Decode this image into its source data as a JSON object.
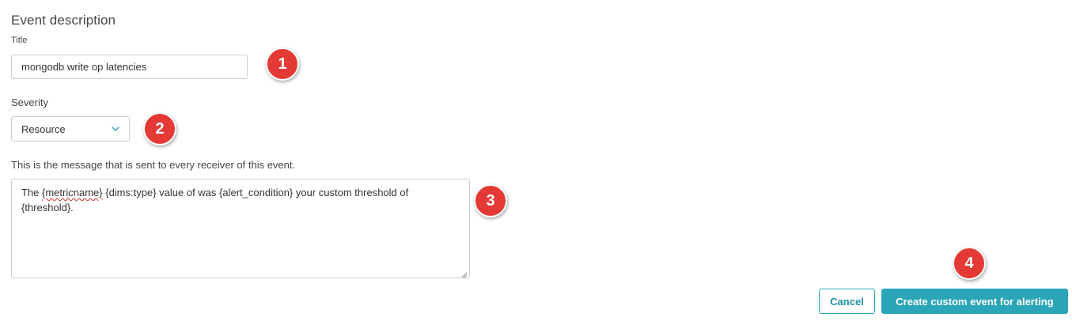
{
  "section": {
    "title": "Event description"
  },
  "title_field": {
    "label": "Title",
    "value": "mongodb write op latencies"
  },
  "severity_field": {
    "label": "Severity",
    "selected": "Resource",
    "icon": "chevron-down-icon"
  },
  "message_field": {
    "label": "This is the message that is sent to every receiver of this event.",
    "text_part1": "The ",
    "text_misspelled": "{metricname}",
    "text_part2": " {dims:type} value of was {alert_condition} your custom threshold of {threshold}."
  },
  "annotations": {
    "badge1": "1",
    "badge2": "2",
    "badge3": "3",
    "badge4": "4",
    "badge_color": "#e53935"
  },
  "actions": {
    "cancel_label": "Cancel",
    "create_label": "Create custom event for alerting",
    "accent_color": "#2aa5b8"
  }
}
